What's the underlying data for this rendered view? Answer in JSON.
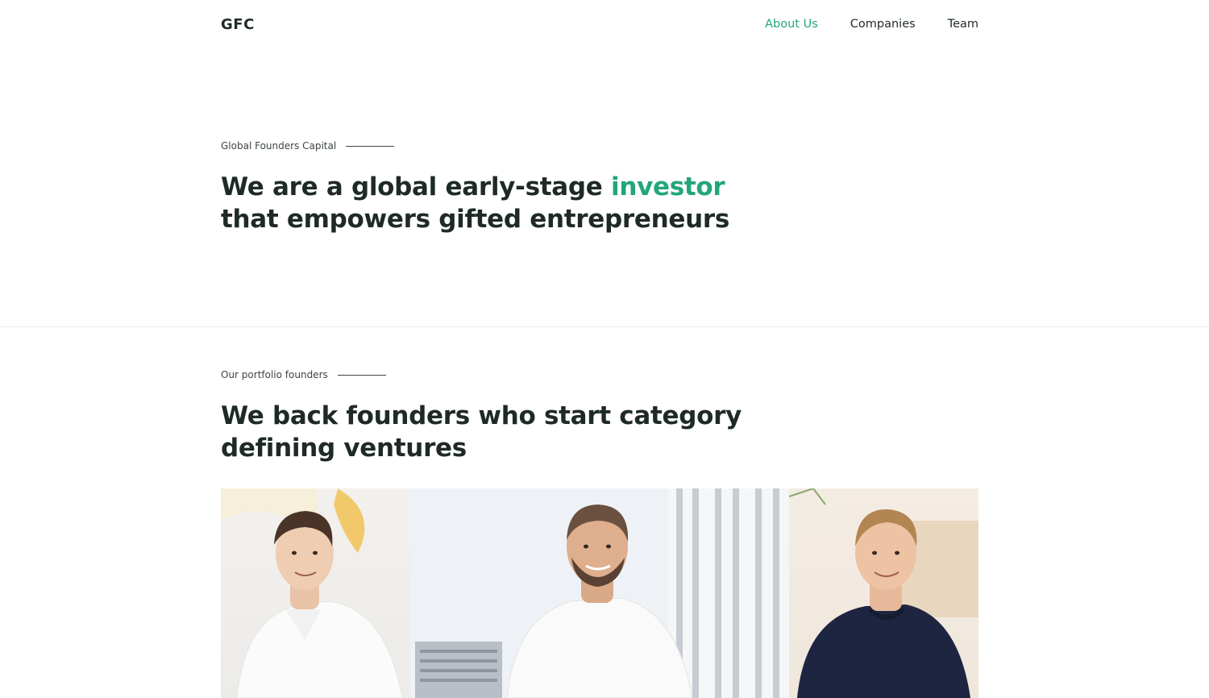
{
  "header": {
    "logo": "GFC",
    "nav": [
      {
        "label": "About Us",
        "active": true
      },
      {
        "label": "Companies",
        "active": false
      },
      {
        "label": "Team",
        "active": false
      }
    ]
  },
  "hero": {
    "eyebrow": "Global Founders Capital",
    "headline_before": "We are a global early-stage ",
    "headline_accent": "investor",
    "headline_after": " that empowers gifted entrepreneurs"
  },
  "portfolio": {
    "eyebrow": "Our portfolio founders",
    "headline": "We back founders who start category defining ventures"
  },
  "colors": {
    "accent": "#22a67a",
    "text": "#1f2a28"
  }
}
